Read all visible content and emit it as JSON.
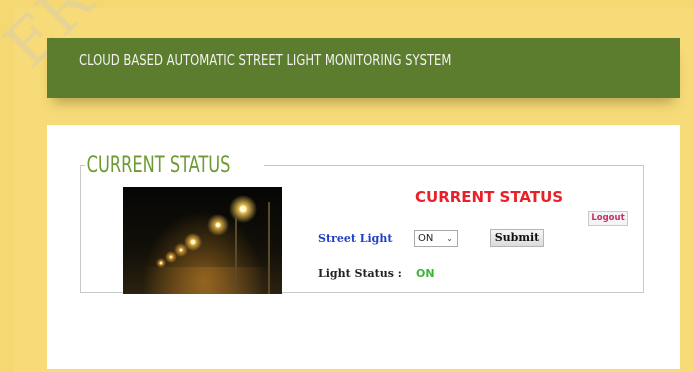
{
  "header": {
    "title": "CLOUD BASED AUTOMATIC STREET LIGHT MONITORING SYSTEM"
  },
  "watermark": {
    "text": "ERT"
  },
  "panel": {
    "legend": "CURRENT STATUS",
    "heading": "CURRENT STATUS",
    "logout_label": "Logout",
    "street_light_label": "Street Light",
    "street_light_value": "ON",
    "submit_label": "Submit",
    "light_status_label": "Light Status :",
    "light_status_value": "ON",
    "image_icon": "street-lights-night-photo"
  },
  "colors": {
    "header_bg": "#5c7d2e",
    "page_bg": "#f7db78",
    "legend": "#6e9a34",
    "heading": "#e8202a",
    "status_on": "#3fb33a",
    "label_blue": "#2140c8",
    "logout": "#c0306a"
  }
}
